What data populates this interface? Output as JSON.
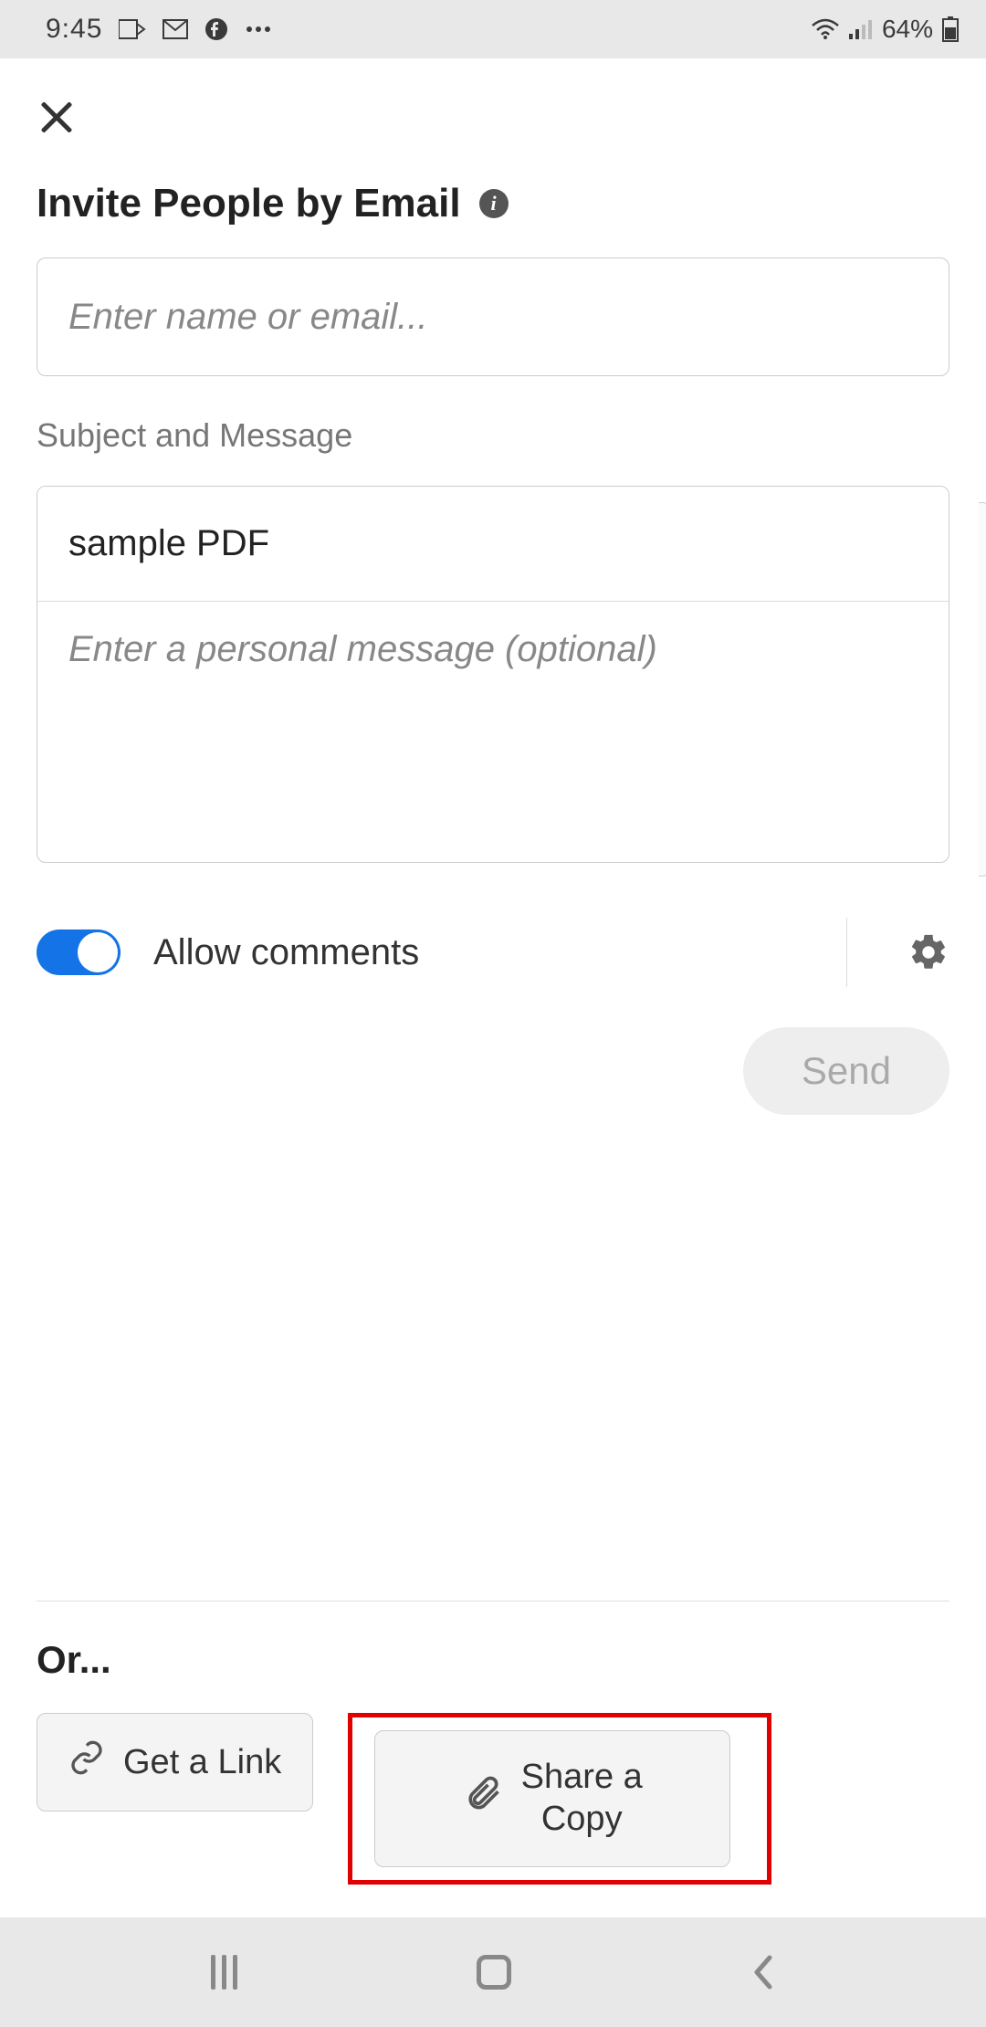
{
  "status": {
    "time": "9:45",
    "battery": "64%"
  },
  "invite": {
    "title": "Invite People by Email",
    "email_placeholder": "Enter name or email...",
    "subject_label": "Subject and Message",
    "subject_value": "sample PDF",
    "message_placeholder": "Enter a personal message (optional)",
    "allow_comments_label": "Allow comments",
    "allow_comments_on": true,
    "send_label": "Send"
  },
  "alt": {
    "or_label": "Or...",
    "get_link_label": "Get a Link",
    "share_copy_line1": "Share a",
    "share_copy_line2": "Copy"
  }
}
